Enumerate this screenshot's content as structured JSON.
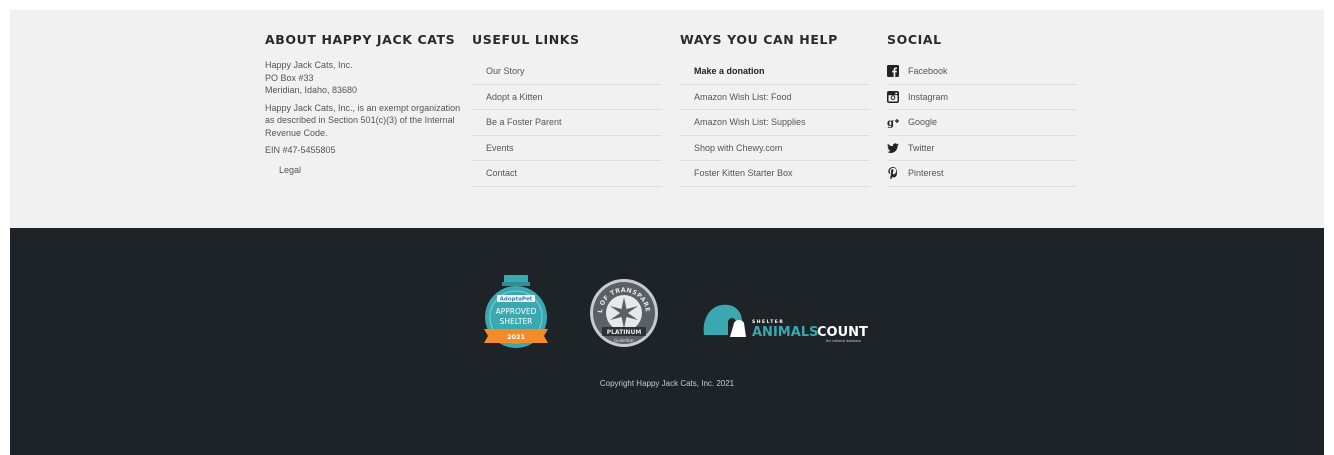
{
  "about": {
    "heading": "ABOUT HAPPY JACK CATS",
    "address_line1": "Happy Jack Cats, Inc.",
    "address_line2": "PO Box #33",
    "address_line3": "Meridian, Idaho, 83680",
    "exempt_text": "Happy Jack Cats, Inc., is an exempt organization as described in Section 501(c)(3) of the Internal Revenue Code.",
    "ein": "EIN #47-5455805",
    "legal": "Legal"
  },
  "useful_links": {
    "heading": "USEFUL LINKS",
    "items": [
      "Our Story",
      "Adopt a Kitten",
      "Be a Foster Parent",
      "Events",
      "Contact"
    ]
  },
  "help": {
    "heading": "WAYS YOU CAN HELP",
    "items": [
      "Make a donation",
      "Amazon Wish List: Food",
      "Amazon Wish List: Supplies",
      "Shop with Chewy.com",
      "Foster Kitten Starter Box"
    ]
  },
  "social": {
    "heading": "SOCIAL",
    "items": [
      {
        "label": "Facebook",
        "icon": "facebook-icon"
      },
      {
        "label": "Instagram",
        "icon": "instagram-icon"
      },
      {
        "label": "Google",
        "icon": "google-plus-icon"
      },
      {
        "label": "Twitter",
        "icon": "twitter-icon"
      },
      {
        "label": "Pinterest",
        "icon": "pinterest-icon"
      }
    ]
  },
  "badges": {
    "adoptapet": {
      "brand": "AdoptaPet",
      "line1": "APPROVED",
      "line2": "SHELTER",
      "year": "2021"
    },
    "guidestar": {
      "arc": "SEAL OF TRANSPARENCY",
      "ribbon": "PLATINUM",
      "brand": "GuideStar"
    },
    "shelter_animals": {
      "top": "SHELTER",
      "main1": "ANIMALS",
      "main2": "COUNT",
      "sub": "the national database"
    }
  },
  "colors": {
    "top_bg": "#f1f1f1",
    "bottom_bg": "#1d2326",
    "teal": "#3aa8b0",
    "orange": "#f28c28"
  },
  "copyright": "Copyright Happy Jack Cats, Inc. 2021"
}
